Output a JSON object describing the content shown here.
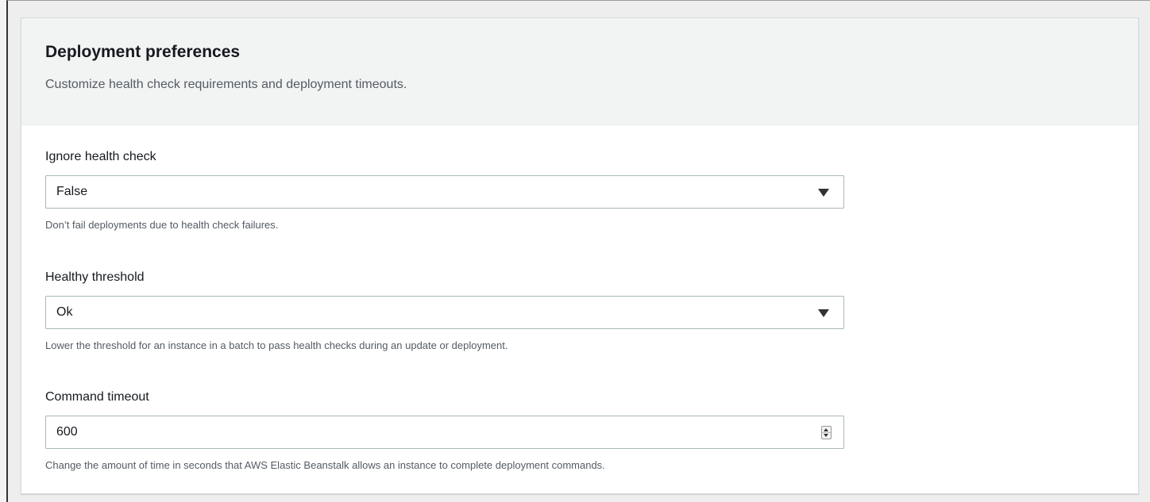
{
  "panel": {
    "title": "Deployment preferences",
    "description": "Customize health check requirements and deployment timeouts."
  },
  "fields": [
    {
      "label": "Ignore health check",
      "value": "False",
      "help": "Don’t fail deployments due to health check failures.",
      "control": "select",
      "icon": "chevron-down-icon"
    },
    {
      "label": "Healthy threshold",
      "value": "Ok",
      "help": "Lower the threshold for an instance in a batch to pass health checks during an update or deployment.",
      "control": "select",
      "icon": "chevron-down-icon"
    },
    {
      "label": "Command timeout",
      "value": "600",
      "help": "Change the amount of time in seconds that AWS Elastic Beanstalk allows an instance to complete deployment commands.",
      "control": "number",
      "icon": "spinner-icon"
    }
  ]
}
